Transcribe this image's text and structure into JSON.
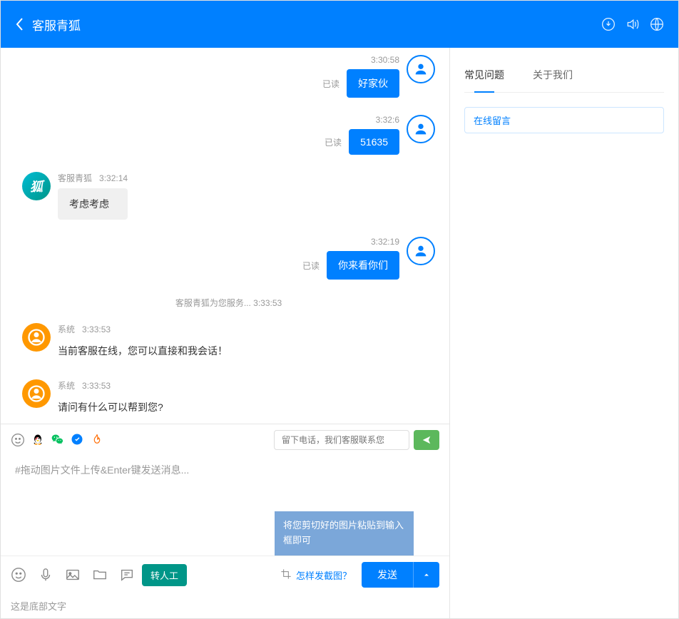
{
  "header": {
    "title": "客服青狐"
  },
  "messages": [
    {
      "type": "out",
      "time": "3:30:58",
      "read": "已读",
      "text": "好家伙"
    },
    {
      "type": "out",
      "time": "3:32:6",
      "read": "已读",
      "text": "51635"
    },
    {
      "type": "in_fox",
      "name": "客服青狐",
      "time": "3:32:14",
      "text": "考虑考虑",
      "avatar_text": "狐"
    },
    {
      "type": "out",
      "time": "3:32:19",
      "read": "已读",
      "text": "你来看你们"
    },
    {
      "type": "notice",
      "text": "客服青狐为您服务...   3:33:53"
    },
    {
      "type": "in_sys",
      "name": "系统",
      "time": "3:33:53",
      "text": "当前客服在线，您可以直接和我会话！"
    },
    {
      "type": "in_sys",
      "name": "系统",
      "time": "3:33:53",
      "text": "请问有什么可以帮到您?"
    }
  ],
  "toolbar": {
    "phone_placeholder": "留下电话，我们客服联系您"
  },
  "input": {
    "placeholder": "#拖动图片文件上传&Enter键发送消息...",
    "paste_tip": "将您剪切好的图片粘贴到输入框即可"
  },
  "bottom": {
    "transfer": "转人工",
    "screenshot_hint": "怎样发截图？",
    "send": "发送"
  },
  "footer": "这是底部文字",
  "side": {
    "tabs": [
      {
        "label": "常见问题",
        "active": true
      },
      {
        "label": "关于我们",
        "active": false
      }
    ],
    "faq": "在线留言"
  }
}
